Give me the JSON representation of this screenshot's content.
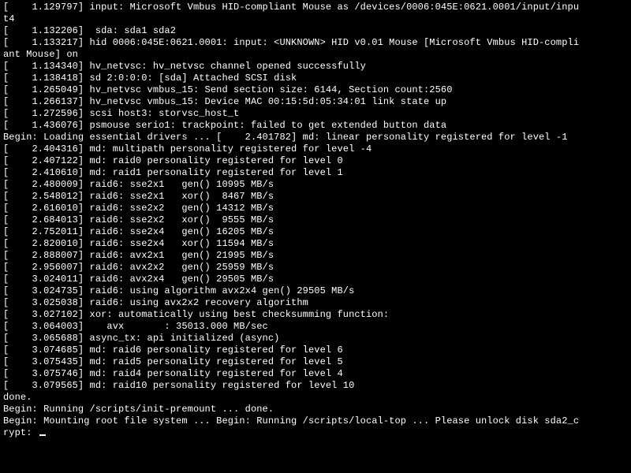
{
  "console": {
    "lines": [
      "[    1.129797] input: Microsoft Vmbus HID-compliant Mouse as /devices/0006:045E:0621.0001/input/inpu",
      "t4",
      "[    1.132206]  sda: sda1 sda2",
      "[    1.133217] hid 0006:045E:0621.0001: input: <UNKNOWN> HID v0.01 Mouse [Microsoft Vmbus HID-compli",
      "ant Mouse] on",
      "[    1.134340] hv_netvsc: hv_netvsc channel opened successfully",
      "[    1.138418] sd 2:0:0:0: [sda] Attached SCSI disk",
      "[    1.265049] hv_netvsc vmbus_15: Send section size: 6144, Section count:2560",
      "[    1.266137] hv_netvsc vmbus_15: Device MAC 00:15:5d:05:34:01 link state up",
      "[    1.272596] scsi host3: storvsc_host_t",
      "[    1.436076] psmouse serio1: trackpoint: failed to get extended button data",
      "Begin: Loading essential drivers ... [    2.401782] md: linear personality registered for level -1",
      "[    2.404316] md: multipath personality registered for level -4",
      "[    2.407122] md: raid0 personality registered for level 0",
      "[    2.410610] md: raid1 personality registered for level 1",
      "[    2.480009] raid6: sse2x1   gen() 10995 MB/s",
      "[    2.548012] raid6: sse2x1   xor()  8467 MB/s",
      "[    2.616010] raid6: sse2x2   gen() 14312 MB/s",
      "[    2.684013] raid6: sse2x2   xor()  9555 MB/s",
      "[    2.752011] raid6: sse2x4   gen() 16205 MB/s",
      "[    2.820010] raid6: sse2x4   xor() 11594 MB/s",
      "[    2.888007] raid6: avx2x1   gen() 21995 MB/s",
      "[    2.956007] raid6: avx2x2   gen() 25959 MB/s",
      "[    3.024011] raid6: avx2x4   gen() 29505 MB/s",
      "[    3.024735] raid6: using algorithm avx2x4 gen() 29505 MB/s",
      "[    3.025038] raid6: using avx2x2 recovery algorithm",
      "[    3.027102] xor: automatically using best checksumming function:",
      "[    3.064003]    avx       : 35013.000 MB/sec",
      "[    3.065688] async_tx: api initialized (async)",
      "[    3.074685] md: raid6 personality registered for level 6",
      "[    3.075435] md: raid5 personality registered for level 5",
      "[    3.075746] md: raid4 personality registered for level 4",
      "[    3.079565] md: raid10 personality registered for level 10",
      "done.",
      "Begin: Running /scripts/init-premount ... done.",
      "Begin: Mounting root file system ... Begin: Running /scripts/local-top ... Please unlock disk sda2_c",
      "rypt: "
    ],
    "cursor_visible": true
  }
}
